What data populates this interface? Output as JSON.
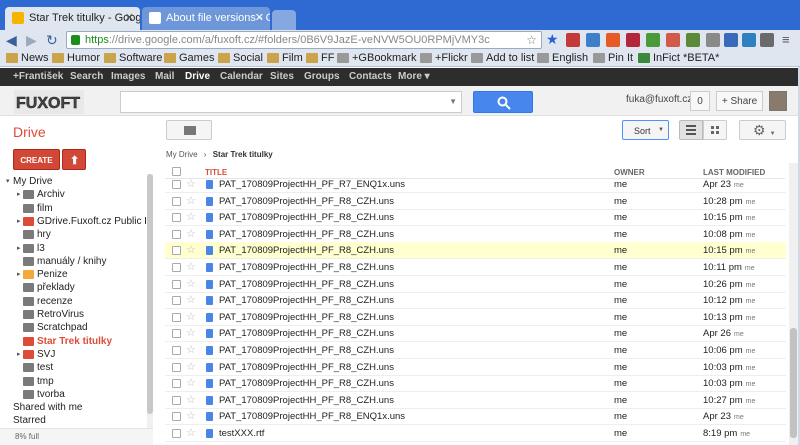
{
  "browser": {
    "tabs": [
      {
        "title": "Star Trek titulky - Goog",
        "favicon_color": "#f4b400"
      },
      {
        "title": "About file versions - Go",
        "favicon_color": "#4285f4"
      }
    ],
    "url_https": "https",
    "url_rest": "://drive.google.com/a/fuxoft.cz/#folders/0B6V9JazE-veNVW5OU0RPMjVMY3c",
    "bookmarks": [
      "News",
      "Humor",
      "Software",
      "Games",
      "Social",
      "Film",
      "FF",
      "+GBookmark",
      "+Flickr",
      "Add to list",
      "English",
      "Pin It",
      "InFict *BETA*"
    ]
  },
  "gbar": {
    "links": [
      "+František",
      "Search",
      "Images",
      "Mail",
      "Drive",
      "Calendar",
      "Sites",
      "Groups",
      "Contacts",
      "More ▾"
    ],
    "active": "Drive"
  },
  "header": {
    "logo_text": "FUXOFT",
    "user_email": "fuka@fuxoft.cz",
    "notification_count": "0",
    "share_label": "+ Share"
  },
  "sidebar": {
    "drive_label": "Drive",
    "create_label": "CREATE",
    "tree": [
      {
        "label": "My Drive",
        "level": 0,
        "arrow": "▾",
        "folder": false
      },
      {
        "label": "Archiv",
        "level": 1,
        "arrow": "▸",
        "folder": "#7a7a7a"
      },
      {
        "label": "film",
        "level": 1,
        "arrow": "",
        "folder": "#7a7a7a"
      },
      {
        "label": "GDrive.Fuxoft.cz Public Fo",
        "level": 1,
        "arrow": "▸",
        "folder": "#dd4b39"
      },
      {
        "label": "hry",
        "level": 1,
        "arrow": "",
        "folder": "#7a7a7a"
      },
      {
        "label": "l3",
        "level": 1,
        "arrow": "▸",
        "folder": "#7a7a7a"
      },
      {
        "label": "manuály / knihy",
        "level": 1,
        "arrow": "",
        "folder": "#7a7a7a"
      },
      {
        "label": "Penize",
        "level": 1,
        "arrow": "▸",
        "folder": "#f4a83c"
      },
      {
        "label": "překlady",
        "level": 1,
        "arrow": "",
        "folder": "#7a7a7a"
      },
      {
        "label": "recenze",
        "level": 1,
        "arrow": "",
        "folder": "#7a7a7a"
      },
      {
        "label": "RetroVirus",
        "level": 1,
        "arrow": "",
        "folder": "#7a7a7a"
      },
      {
        "label": "Scratchpad",
        "level": 1,
        "arrow": "",
        "folder": "#7a7a7a"
      },
      {
        "label": "Star Trek titulky",
        "level": 1,
        "arrow": "",
        "folder": "#dd4b39",
        "selected": true
      },
      {
        "label": "SVJ",
        "level": 1,
        "arrow": "▸",
        "folder": "#dd4b39"
      },
      {
        "label": "test",
        "level": 1,
        "arrow": "",
        "folder": "#7a7a7a"
      },
      {
        "label": "tmp",
        "level": 1,
        "arrow": "",
        "folder": "#7a7a7a"
      },
      {
        "label": "tvorba",
        "level": 1,
        "arrow": "",
        "folder": "#7a7a7a"
      },
      {
        "label": "Shared with me",
        "level": 0,
        "arrow": "",
        "folder": false
      },
      {
        "label": "Starred",
        "level": 0,
        "arrow": "",
        "folder": false
      }
    ],
    "quota": "8% full"
  },
  "toolbar": {
    "sort_label": "Sort"
  },
  "main": {
    "breadcrumb_root": "My Drive",
    "breadcrumb_sep": "›",
    "breadcrumb_current": "Star Trek titulky",
    "columns": {
      "title": "TITLE",
      "owner": "OWNER",
      "modified": "LAST MODIFIED"
    },
    "rows": [
      {
        "name": "PAT_170809ProjectHH_PF_R7_ENQ1x.uns",
        "owner": "me",
        "date": "Apr 23",
        "by": "me"
      },
      {
        "name": "PAT_170809ProjectHH_PF_R8_CZH.uns",
        "owner": "me",
        "date": "10:28 pm",
        "by": "me"
      },
      {
        "name": "PAT_170809ProjectHH_PF_R8_CZH.uns",
        "owner": "me",
        "date": "10:15 pm",
        "by": "me"
      },
      {
        "name": "PAT_170809ProjectHH_PF_R8_CZH.uns",
        "owner": "me",
        "date": "10:08 pm",
        "by": "me"
      },
      {
        "name": "PAT_170809ProjectHH_PF_R8_CZH.uns",
        "owner": "me",
        "date": "10:15 pm",
        "by": "me",
        "highlight": true
      },
      {
        "name": "PAT_170809ProjectHH_PF_R8_CZH.uns",
        "owner": "me",
        "date": "10:11 pm",
        "by": "me"
      },
      {
        "name": "PAT_170809ProjectHH_PF_R8_CZH.uns",
        "owner": "me",
        "date": "10:26 pm",
        "by": "me"
      },
      {
        "name": "PAT_170809ProjectHH_PF_R8_CZH.uns",
        "owner": "me",
        "date": "10:12 pm",
        "by": "me"
      },
      {
        "name": "PAT_170809ProjectHH_PF_R8_CZH.uns",
        "owner": "me",
        "date": "10:13 pm",
        "by": "me"
      },
      {
        "name": "PAT_170809ProjectHH_PF_R8_CZH.uns",
        "owner": "me",
        "date": "Apr 26",
        "by": "me"
      },
      {
        "name": "PAT_170809ProjectHH_PF_R8_CZH.uns",
        "owner": "me",
        "date": "10:06 pm",
        "by": "me"
      },
      {
        "name": "PAT_170809ProjectHH_PF_R8_CZH.uns",
        "owner": "me",
        "date": "10:03 pm",
        "by": "me"
      },
      {
        "name": "PAT_170809ProjectHH_PF_R8_CZH.uns",
        "owner": "me",
        "date": "10:03 pm",
        "by": "me"
      },
      {
        "name": "PAT_170809ProjectHH_PF_R8_CZH.uns",
        "owner": "me",
        "date": "10:27 pm",
        "by": "me"
      },
      {
        "name": "PAT_170809ProjectHH_PF_R8_ENQ1x.uns",
        "owner": "me",
        "date": "Apr 23",
        "by": "me"
      },
      {
        "name": "testXXX.rtf",
        "owner": "me",
        "date": "8:19 pm",
        "by": "me"
      }
    ]
  },
  "colors": {
    "accent_red": "#dd4b39",
    "blue_button": "#4787ed",
    "row_highlight": "#ffffd0",
    "chrome_blue": "#2e6ad1"
  }
}
